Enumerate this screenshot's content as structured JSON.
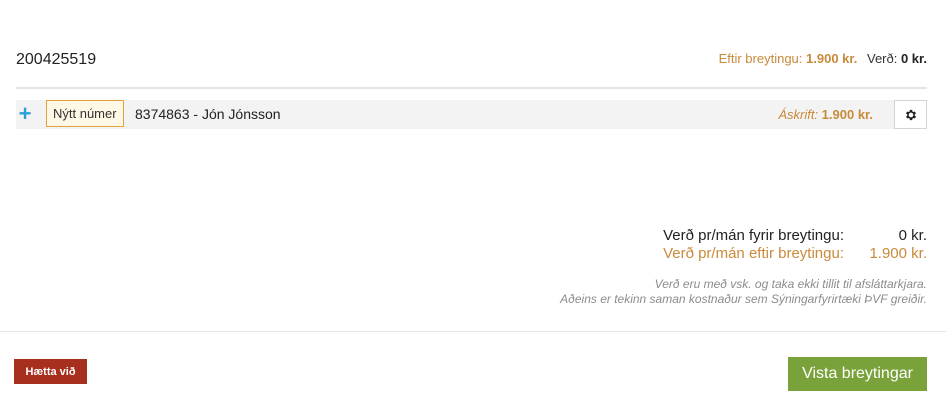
{
  "account": {
    "id": "200425519"
  },
  "summary": {
    "after_label": "Eftir breytingu:",
    "after_value": "1.900 kr.",
    "price_label": "Verð:",
    "price_value": "0 kr."
  },
  "subscription": {
    "new_number_badge": "Nýtt númer",
    "line": "8374863 - Jón Jónsson",
    "price_label": "Áskrift:",
    "price_value": "1.900 kr."
  },
  "totals": {
    "before_label": "Verð pr/mán fyrir breytingu:",
    "before_value": "0 kr.",
    "after_label": "Verð pr/mán eftir breytingu:",
    "after_value": "1.900 kr."
  },
  "notes": {
    "line1": "Verð eru með vsk. og taka ekki tillit til afsláttarkjara.",
    "line2": "Aðeins er tekinn saman kostnaður sem Sýningarfyrirtæki ÞVF greiðir."
  },
  "actions": {
    "cancel_label": "Hætta við",
    "save_label": "Vista breytingar"
  },
  "icons": {
    "add": "plus-icon",
    "settings": "gear-icon"
  },
  "colors": {
    "accent_orange": "#c98a3a",
    "add_blue": "#2a9fd8",
    "cancel_red": "#a6301d",
    "save_green": "#7aa23a"
  }
}
